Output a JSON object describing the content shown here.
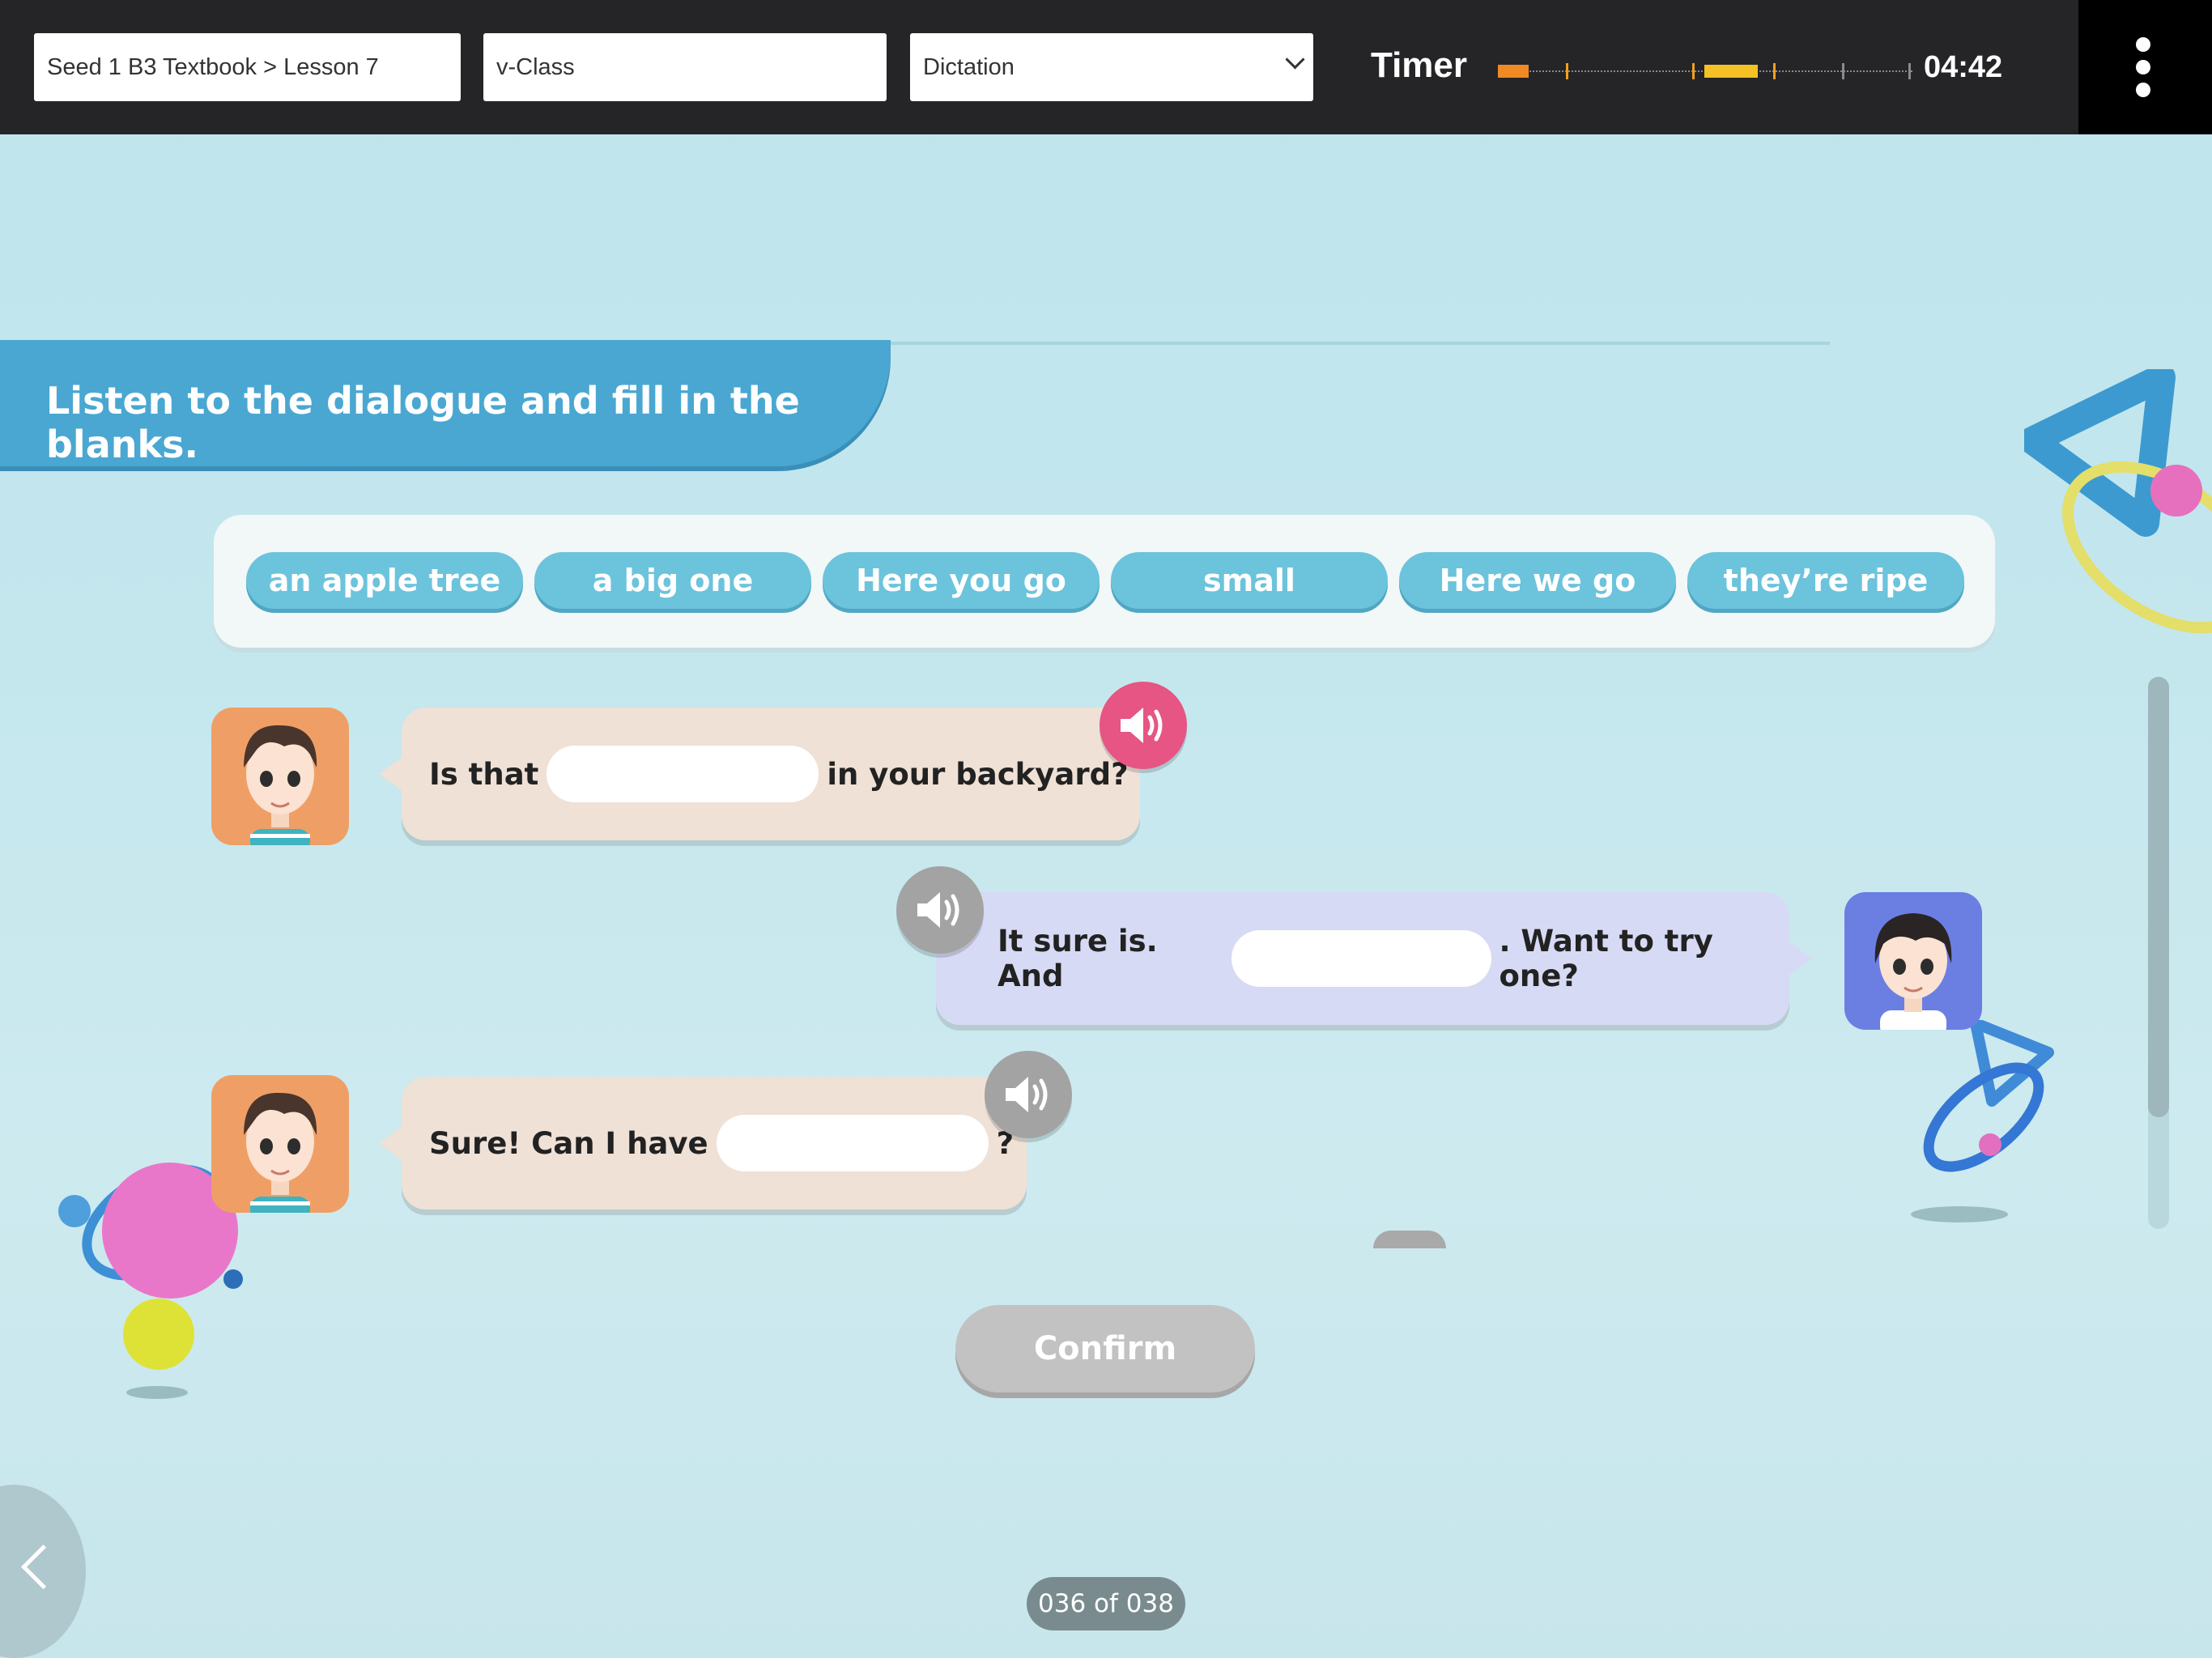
{
  "toolbar": {
    "breadcrumb": "Seed 1 B3 Textbook > Lesson 7",
    "class_name": "v-Class",
    "mode": "Dictation",
    "timer_label": "Timer",
    "timer_value": "04:42"
  },
  "instruction": "Listen to the dialogue and fill in the blanks.",
  "word_bank": [
    "an apple tree",
    "a big one",
    "Here you go",
    "small",
    "Here we go",
    "they’re ripe"
  ],
  "dialogue": [
    {
      "speaker": "boy-orange",
      "before": "Is that",
      "after": "in your backyard?",
      "audio": "active"
    },
    {
      "speaker": "boy-blue",
      "before": "It sure is. And",
      "after": ". Want to try one?",
      "audio": "inactive"
    },
    {
      "speaker": "boy-orange",
      "before": "Sure! Can I have",
      "after": "?",
      "audio": "inactive"
    }
  ],
  "confirm_label": "Confirm",
  "pager": "036 of 038",
  "colors": {
    "accent": "#4aa7d1",
    "chip": "#6cc3dc",
    "audio_active": "#e65583",
    "topbar": "#252527"
  }
}
